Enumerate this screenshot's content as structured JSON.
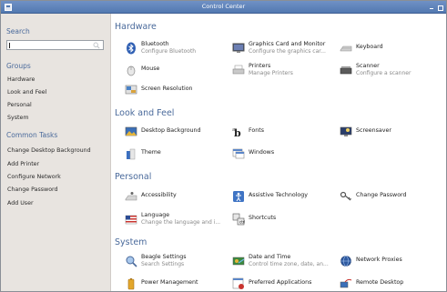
{
  "window": {
    "title": "Control Center"
  },
  "sidebar": {
    "search_heading": "Search",
    "search_value": "",
    "groups_heading": "Groups",
    "groups": [
      "Hardware",
      "Look and Feel",
      "Personal",
      "System"
    ],
    "tasks_heading": "Common Tasks",
    "tasks": [
      "Change Desktop Background",
      "Add Printer",
      "Configure Network",
      "Change Password",
      "Add User"
    ]
  },
  "sections": {
    "hardware": {
      "title": "Hardware",
      "items": [
        {
          "label": "Bluetooth",
          "sub": "Configure Bluetooth",
          "icon": "bluetooth-icon"
        },
        {
          "label": "Graphics Card and Monitor",
          "sub": "Configure the graphics car...",
          "icon": "monitor-icon"
        },
        {
          "label": "Keyboard",
          "sub": "",
          "icon": "keyboard-icon"
        },
        {
          "label": "Mouse",
          "sub": "",
          "icon": "mouse-icon"
        },
        {
          "label": "Printers",
          "sub": "Manage Printers",
          "icon": "printer-icon"
        },
        {
          "label": "Scanner",
          "sub": "Configure a scanner",
          "icon": "scanner-icon"
        },
        {
          "label": "Screen Resolution",
          "sub": "",
          "icon": "screen-resolution-icon"
        }
      ]
    },
    "look": {
      "title": "Look and Feel",
      "items": [
        {
          "label": "Desktop Background",
          "sub": "",
          "icon": "desktop-background-icon"
        },
        {
          "label": "Fonts",
          "sub": "",
          "icon": "fonts-icon"
        },
        {
          "label": "Screensaver",
          "sub": "",
          "icon": "screensaver-icon"
        },
        {
          "label": "Theme",
          "sub": "",
          "icon": "theme-icon"
        },
        {
          "label": "Windows",
          "sub": "",
          "icon": "windows-icon"
        }
      ]
    },
    "personal": {
      "title": "Personal",
      "items": [
        {
          "label": "Accessibility",
          "sub": "",
          "icon": "accessibility-icon"
        },
        {
          "label": "Assistive Technology",
          "sub": "",
          "icon": "assistive-technology-icon"
        },
        {
          "label": "Change Password",
          "sub": "",
          "icon": "password-icon"
        },
        {
          "label": "Language",
          "sub": "Change the language and i...",
          "icon": "language-icon"
        },
        {
          "label": "Shortcuts",
          "sub": "",
          "icon": "shortcuts-icon"
        }
      ]
    },
    "system": {
      "title": "System",
      "items": [
        {
          "label": "Beagle Settings",
          "sub": "Search Settings",
          "icon": "beagle-icon"
        },
        {
          "label": "Date and Time",
          "sub": "Control time zone, date, an...",
          "icon": "date-time-icon"
        },
        {
          "label": "Network Proxies",
          "sub": "",
          "icon": "network-proxies-icon"
        },
        {
          "label": "Power Management",
          "sub": "",
          "icon": "power-management-icon"
        },
        {
          "label": "Preferred Applications",
          "sub": "",
          "icon": "preferred-applications-icon"
        },
        {
          "label": "Remote Desktop",
          "sub": "",
          "icon": "remote-desktop-icon"
        }
      ]
    }
  }
}
